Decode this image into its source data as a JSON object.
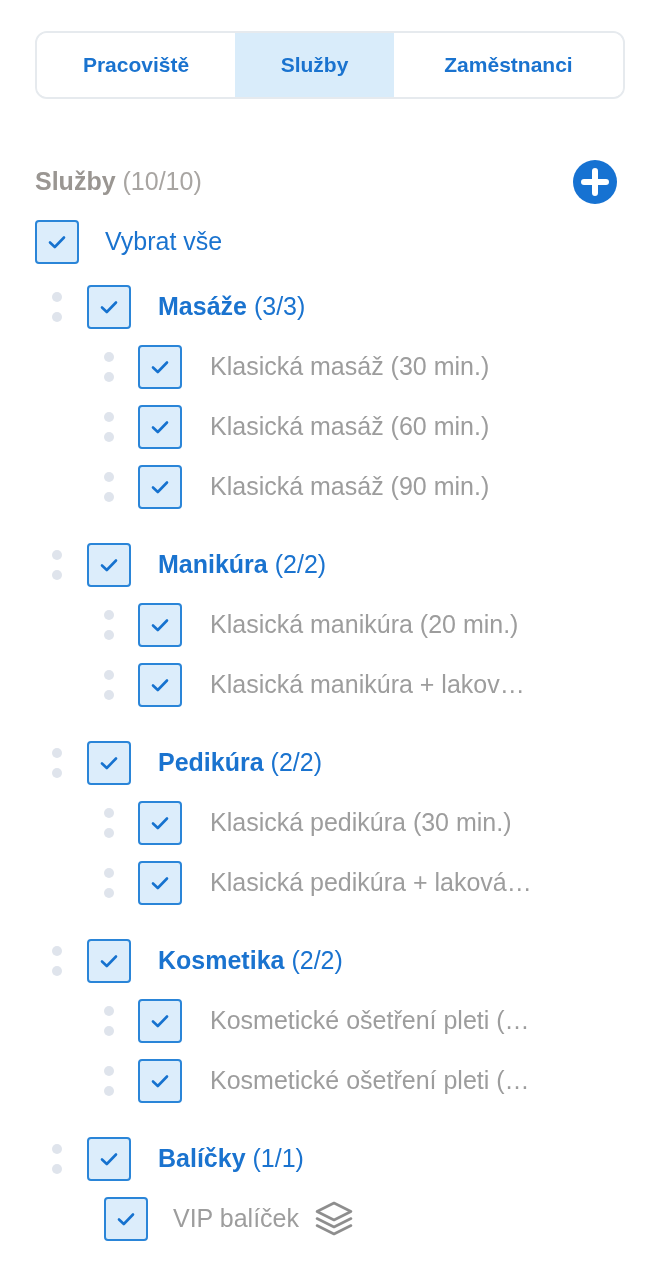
{
  "tabs": [
    {
      "label": "Pracoviště",
      "selected": false
    },
    {
      "label": "Služby",
      "selected": true
    },
    {
      "label": "Zaměstnanci",
      "selected": false
    }
  ],
  "header": {
    "title": "Služby",
    "count": "(10/10)"
  },
  "select_all": {
    "label": "Vybrat vše",
    "checked": true
  },
  "groups": [
    {
      "name": "Masáže",
      "count": "(3/3)",
      "checked": true,
      "children": [
        {
          "kind": "service",
          "label": "Klasická masáž (30 min.)",
          "checked": true
        },
        {
          "kind": "service",
          "label": "Klasická masáž (60 min.)",
          "checked": true
        },
        {
          "kind": "service",
          "label": "Klasická masáž (90 min.)",
          "checked": true
        }
      ]
    },
    {
      "name": "Manikúra",
      "count": "(2/2)",
      "checked": true,
      "children": [
        {
          "kind": "service",
          "label": "Klasická manikúra (20 min.)",
          "checked": true
        },
        {
          "kind": "service",
          "label": "Klasická manikúra + lakov…",
          "checked": true
        }
      ]
    },
    {
      "name": "Pedikúra",
      "count": "(2/2)",
      "checked": true,
      "children": [
        {
          "kind": "service",
          "label": "Klasická pedikúra (30 min.)",
          "checked": true
        },
        {
          "kind": "service",
          "label": "Klasická pedikúra + laková…",
          "checked": true
        }
      ]
    },
    {
      "name": "Kosmetika",
      "count": "(2/2)",
      "checked": true,
      "children": [
        {
          "kind": "service",
          "label": "Kosmetické ošetření pleti (…",
          "checked": true
        },
        {
          "kind": "service",
          "label": "Kosmetické ošetření pleti (…",
          "checked": true
        }
      ]
    },
    {
      "name": "Balíčky",
      "count": "(1/1)",
      "checked": true,
      "children": [
        {
          "kind": "package",
          "label": "VIP balíček",
          "checked": true
        }
      ]
    }
  ]
}
